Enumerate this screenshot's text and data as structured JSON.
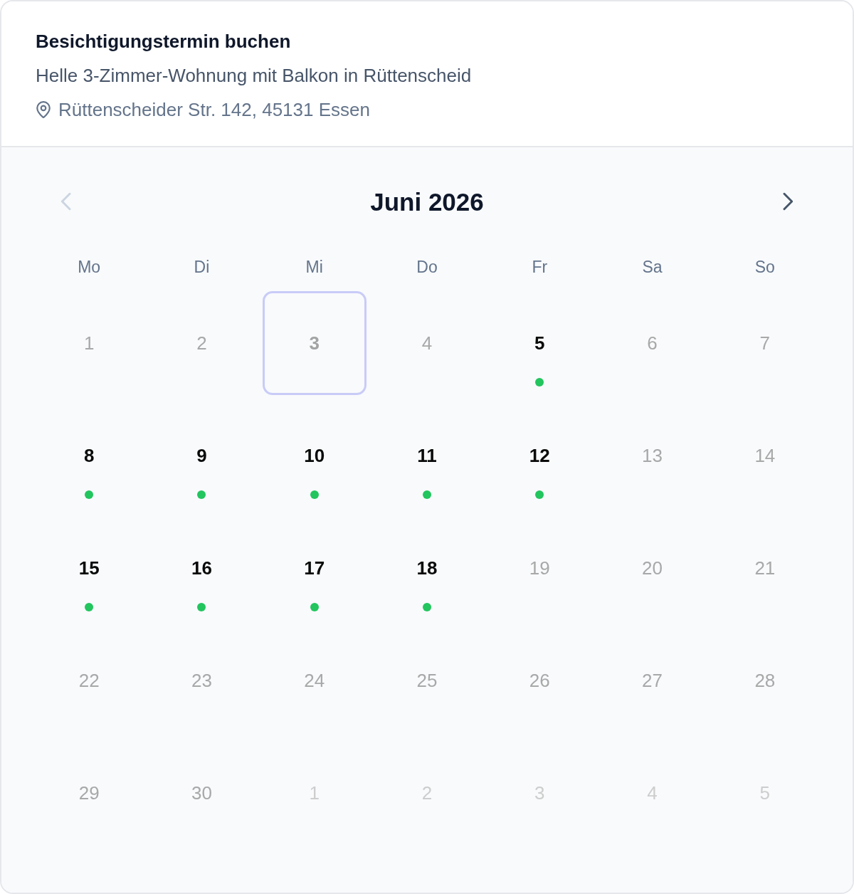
{
  "booking": {
    "title": "Besichtigungstermin buchen",
    "listing": "Helle 3-Zimmer-Wohnung mit Balkon in Rüttenscheid",
    "address": "Rüttenscheider Str. 142, 45131 Essen"
  },
  "calendar": {
    "month": "Juni 2026",
    "prev": {
      "disabled": true
    },
    "next": {
      "disabled": false
    },
    "weekdays": [
      "Mo",
      "Di",
      "Mi",
      "Do",
      "Fr",
      "Sa",
      "So"
    ],
    "days": [
      {
        "label": "1",
        "available": false,
        "outside_month": false,
        "today": false
      },
      {
        "label": "2",
        "available": false,
        "outside_month": false,
        "today": false
      },
      {
        "label": "3",
        "available": false,
        "outside_month": false,
        "today": true
      },
      {
        "label": "4",
        "available": false,
        "outside_month": false,
        "today": false
      },
      {
        "label": "5",
        "available": true,
        "outside_month": false,
        "today": false
      },
      {
        "label": "6",
        "available": false,
        "outside_month": false,
        "today": false
      },
      {
        "label": "7",
        "available": false,
        "outside_month": false,
        "today": false
      },
      {
        "label": "8",
        "available": true,
        "outside_month": false,
        "today": false
      },
      {
        "label": "9",
        "available": true,
        "outside_month": false,
        "today": false
      },
      {
        "label": "10",
        "available": true,
        "outside_month": false,
        "today": false
      },
      {
        "label": "11",
        "available": true,
        "outside_month": false,
        "today": false
      },
      {
        "label": "12",
        "available": true,
        "outside_month": false,
        "today": false
      },
      {
        "label": "13",
        "available": false,
        "outside_month": false,
        "today": false
      },
      {
        "label": "14",
        "available": false,
        "outside_month": false,
        "today": false
      },
      {
        "label": "15",
        "available": true,
        "outside_month": false,
        "today": false
      },
      {
        "label": "16",
        "available": true,
        "outside_month": false,
        "today": false
      },
      {
        "label": "17",
        "available": true,
        "outside_month": false,
        "today": false
      },
      {
        "label": "18",
        "available": true,
        "outside_month": false,
        "today": false
      },
      {
        "label": "19",
        "available": false,
        "outside_month": false,
        "today": false
      },
      {
        "label": "20",
        "available": false,
        "outside_month": false,
        "today": false
      },
      {
        "label": "21",
        "available": false,
        "outside_month": false,
        "today": false
      },
      {
        "label": "22",
        "available": false,
        "outside_month": false,
        "today": false
      },
      {
        "label": "23",
        "available": false,
        "outside_month": false,
        "today": false
      },
      {
        "label": "24",
        "available": false,
        "outside_month": false,
        "today": false
      },
      {
        "label": "25",
        "available": false,
        "outside_month": false,
        "today": false
      },
      {
        "label": "26",
        "available": false,
        "outside_month": false,
        "today": false
      },
      {
        "label": "27",
        "available": false,
        "outside_month": false,
        "today": false
      },
      {
        "label": "28",
        "available": false,
        "outside_month": false,
        "today": false
      },
      {
        "label": "29",
        "available": false,
        "outside_month": false,
        "today": false
      },
      {
        "label": "30",
        "available": false,
        "outside_month": false,
        "today": false
      },
      {
        "label": "1",
        "available": false,
        "outside_month": true,
        "today": false
      },
      {
        "label": "2",
        "available": false,
        "outside_month": true,
        "today": false
      },
      {
        "label": "3",
        "available": false,
        "outside_month": true,
        "today": false
      },
      {
        "label": "4",
        "available": false,
        "outside_month": true,
        "today": false
      },
      {
        "label": "5",
        "available": false,
        "outside_month": true,
        "today": false
      }
    ]
  }
}
